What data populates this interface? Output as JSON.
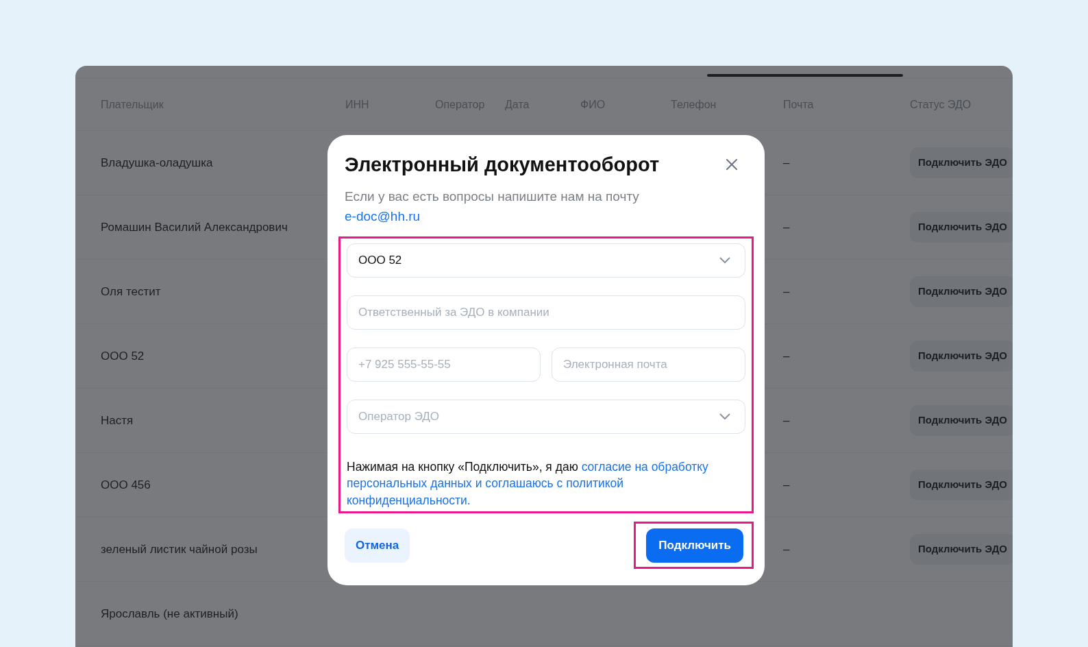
{
  "table": {
    "columns": [
      "Плательщик",
      "ИНН",
      "Оператор",
      "Дата",
      "ФИО",
      "Телефон",
      "Почта",
      "Статус ЭДО"
    ],
    "rows": [
      {
        "payer": "Владушка-оладушка",
        "mail": "–",
        "status_button": "Подключить ЭДО"
      },
      {
        "payer": "Ромашин Василий Александрович",
        "mail": "–",
        "status_button": "Подключить ЭДО"
      },
      {
        "payer": "Оля тестит",
        "mail": "–",
        "status_button": "Подключить ЭДО"
      },
      {
        "payer": "ООО 52",
        "mail": "–",
        "status_button": "Подключить ЭДО"
      },
      {
        "payer": "Настя",
        "mail": "–",
        "status_button": "Подключить ЭДО"
      },
      {
        "payer": "ООО 456",
        "mail": "–",
        "status_button": "Подключить ЭДО"
      },
      {
        "payer": "зеленый листик чайной розы",
        "mail": "–",
        "status_button": "Подключить ЭДО"
      },
      {
        "payer": "Ярославль (не активный)"
      }
    ]
  },
  "modal": {
    "title": "Электронный документооборот",
    "subtitle": "Если у вас есть вопросы напишите нам на почту",
    "email_link": "e-doc@hh.ru",
    "fields": [
      {
        "kind": "select",
        "value": "ООО 52"
      },
      {
        "kind": "text",
        "placeholder": "Ответственный за ЭДО в компании"
      },
      {
        "kind": "pair",
        "items": [
          {
            "placeholder": "+7 925 555-55-55"
          },
          {
            "placeholder": "Электронная почта"
          }
        ]
      },
      {
        "kind": "select",
        "placeholder": "Оператор ЭДО"
      }
    ],
    "consent": {
      "text": "Нажимая на кнопку «Подключить», я даю ",
      "link_lines": [
        "согласие на обработку",
        "персональных данных и соглашаюсь с политикой",
        "конфиденциальности."
      ]
    },
    "cancel_button": "Отмена",
    "submit_button": "Подключить"
  }
}
